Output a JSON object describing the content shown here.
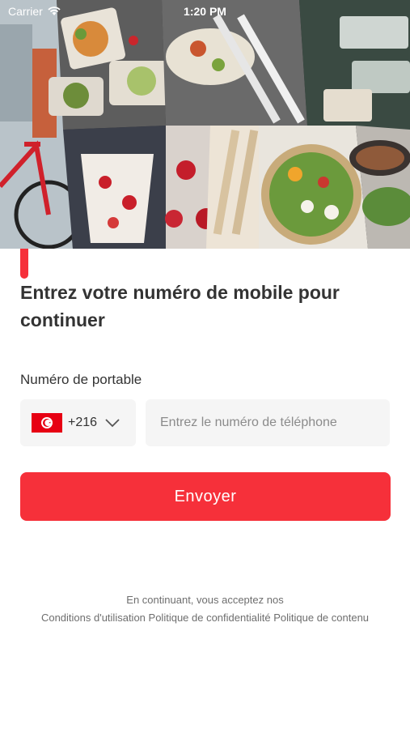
{
  "status_bar": {
    "carrier": "Carrier",
    "time": "1:20 PM"
  },
  "login": {
    "title": "Entrez votre numéro de mobile pour continuer",
    "phone_label": "Numéro de portable",
    "country_code": "+216",
    "country_flag": "tunisia-flag-icon",
    "phone_placeholder": "Entrez le numéro de téléphone",
    "send_label": "Envoyer"
  },
  "legal": {
    "intro": "En continuant, vous acceptez nos",
    "terms": "Conditions d'utilisation",
    "privacy": "Politique de confidentialité",
    "content": "Politique de contenu"
  },
  "colors": {
    "accent": "#f6303a",
    "text": "#333333",
    "field_bg": "#f5f5f5",
    "muted": "#6e6e6e"
  }
}
